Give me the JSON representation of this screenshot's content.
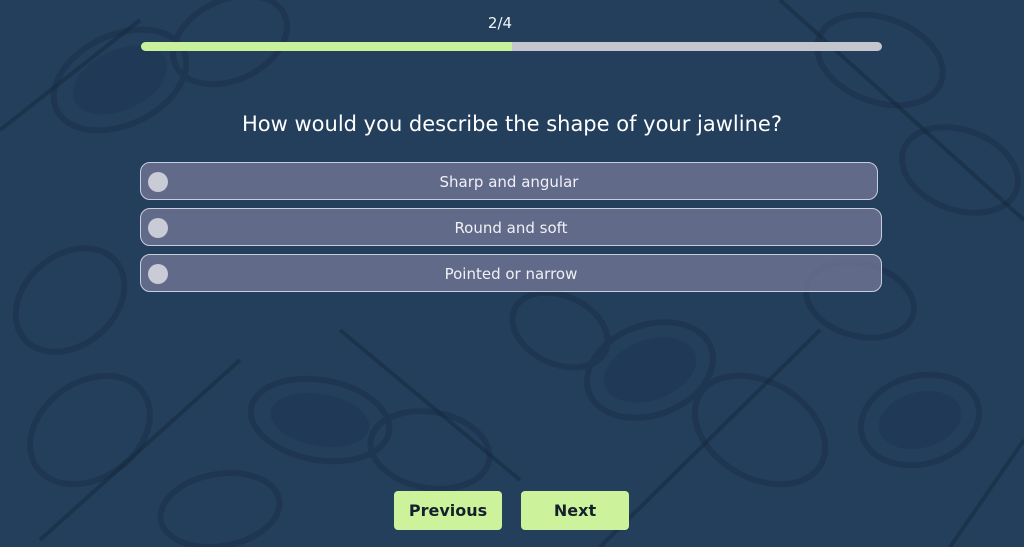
{
  "progress": {
    "label": "2/4",
    "fraction": 0.5
  },
  "question": {
    "text": "How would you describe the shape of your jawline?"
  },
  "options": [
    {
      "label": "Sharp and angular"
    },
    {
      "label": "Round and soft"
    },
    {
      "label": "Pointed or narrow"
    }
  ],
  "nav": {
    "previous_label": "Previous",
    "next_label": "Next"
  },
  "colors": {
    "background": "#243f5c",
    "accent": "#cdf29c",
    "progress_track": "#c3c6cc",
    "option_fill": "#707494"
  }
}
